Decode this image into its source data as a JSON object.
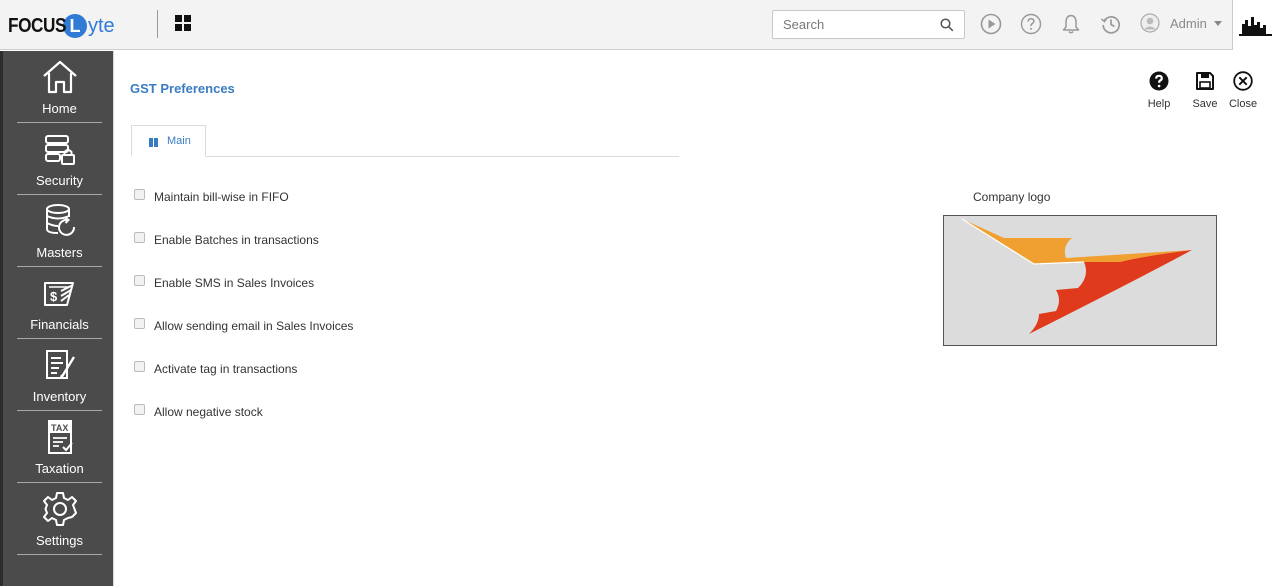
{
  "header": {
    "logo_text_1": "FOCUS",
    "logo_text_l": "L",
    "logo_text_2": "yte",
    "search_placeholder": "Search",
    "user_name": "Admin",
    "icons": [
      "apps-grid-icon",
      "search-icon",
      "play-icon",
      "help-circle-icon",
      "bell-icon",
      "history-icon",
      "user-avatar-icon",
      "caret-down-icon"
    ]
  },
  "sidebar": {
    "items": [
      {
        "label": "Home",
        "icon": "home-icon"
      },
      {
        "label": "Security",
        "icon": "security-icon"
      },
      {
        "label": "Masters",
        "icon": "masters-icon"
      },
      {
        "label": "Financials",
        "icon": "financials-icon"
      },
      {
        "label": "Inventory",
        "icon": "inventory-icon"
      },
      {
        "label": "Taxation",
        "icon": "taxation-icon"
      },
      {
        "label": "Settings",
        "icon": "settings-icon"
      }
    ]
  },
  "page": {
    "title": "GST Preferences",
    "actions": [
      {
        "label": "Help",
        "icon": "help-icon"
      },
      {
        "label": "Save",
        "icon": "save-icon"
      },
      {
        "label": "Close",
        "icon": "close-icon"
      }
    ],
    "tabs": [
      {
        "label": "Main"
      }
    ],
    "options": [
      {
        "label": "Maintain bill-wise in FIFO",
        "checked": false
      },
      {
        "label": "Enable Batches in transactions",
        "checked": false
      },
      {
        "label": "Enable SMS in Sales Invoices",
        "checked": false
      },
      {
        "label": "Allow sending email in Sales Invoices",
        "checked": false
      },
      {
        "label": "Activate tag in transactions",
        "checked": false
      },
      {
        "label": "Allow negative stock",
        "checked": false
      }
    ],
    "company_logo_label": "Company logo"
  },
  "colors": {
    "accent": "#3a7cc2",
    "sidebar_bg": "#4b4b4b",
    "logo_orange": "#f0a030",
    "logo_red": "#e03a1c"
  }
}
